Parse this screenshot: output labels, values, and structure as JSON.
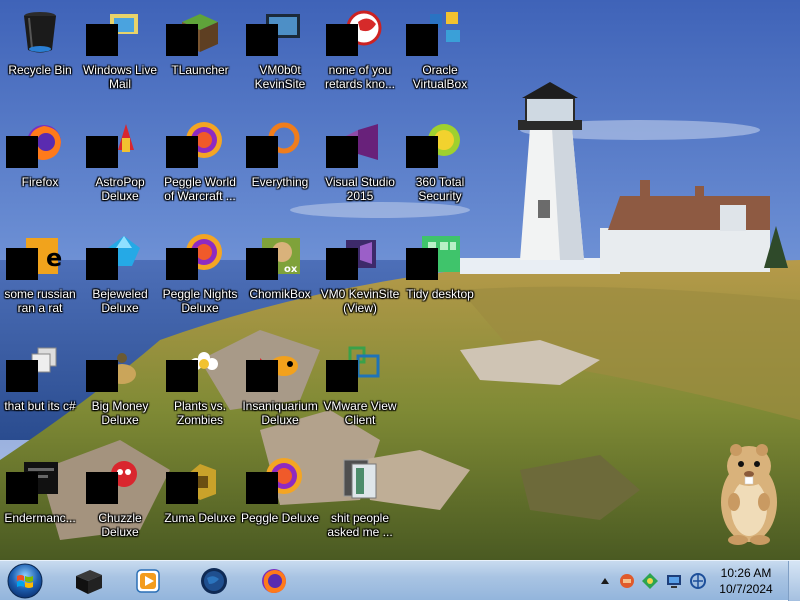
{
  "desktop": {
    "icons": [
      {
        "label": "Recycle Bin",
        "art": "recycle-bin-icon",
        "masked": false
      },
      {
        "label": "Windows Live Mail",
        "art": "mail-icon",
        "masked": true
      },
      {
        "label": "TLauncher",
        "art": "grass-block-icon",
        "masked": true
      },
      {
        "label": "VM0b0t KevinSite",
        "art": "monitor-icon",
        "masked": true
      },
      {
        "label": "none of you retards kno...",
        "art": "red-bird-icon",
        "masked": true
      },
      {
        "label": "Oracle VirtualBox",
        "art": "virtualbox-icon",
        "masked": true
      },
      {
        "label": "Firefox",
        "art": "firefox-icon",
        "masked": true
      },
      {
        "label": "AstroPop Deluxe",
        "art": "astropop-icon",
        "masked": true
      },
      {
        "label": "Peggle World of Warcraft ...",
        "art": "peggle-icon",
        "masked": true
      },
      {
        "label": "Everything",
        "art": "search-ring-icon",
        "masked": true
      },
      {
        "label": "Visual Studio 2015",
        "art": "visual-studio-icon",
        "masked": true
      },
      {
        "label": "360 Total Security",
        "art": "shield-plus-icon",
        "masked": true
      },
      {
        "label": "some russian ran a rat",
        "art": "document-icon",
        "masked": true
      },
      {
        "label": "Bejeweled Deluxe",
        "art": "gem-icon",
        "masked": true
      },
      {
        "label": "Peggle Nights Deluxe",
        "art": "peggle-icon",
        "masked": true
      },
      {
        "label": "ChomikBox",
        "art": "hamster-box-icon",
        "masked": true
      },
      {
        "label": "VM0 KevinSite (View)",
        "art": "vs-window-icon",
        "masked": true
      },
      {
        "label": "Tidy desktop",
        "art": "tidy-grid-icon",
        "masked": true
      },
      {
        "label": "that but its c#",
        "art": "stacked-windows-icon",
        "masked": true
      },
      {
        "label": "Big Money Deluxe",
        "art": "money-icon",
        "masked": true
      },
      {
        "label": "Plants vs. Zombies",
        "art": "flower-icon",
        "masked": true
      },
      {
        "label": "Insaniquarium Deluxe",
        "art": "fish-icon",
        "masked": true
      },
      {
        "label": "VMware View Client",
        "art": "vmware-icon",
        "masked": true
      },
      {
        "label": "Endermanc...",
        "art": "terminal-icon",
        "masked": true
      },
      {
        "label": "Chuzzle Deluxe",
        "art": "chuzzle-icon",
        "masked": true
      },
      {
        "label": "Zuma Deluxe",
        "art": "zuma-icon",
        "masked": true
      },
      {
        "label": "Peggle Deluxe",
        "art": "peggle-icon",
        "masked": true
      },
      {
        "label": "shit people asked me ...",
        "art": "folder-icon",
        "masked": false
      }
    ]
  },
  "taskbar": {
    "start_icon": "windows-start-icon",
    "pinned": [
      {
        "name": "taskbar-app-terminal",
        "icon": "black-box-icon"
      },
      {
        "name": "taskbar-app-media-player",
        "icon": "media-player-icon"
      },
      {
        "name": "taskbar-app-globe",
        "icon": "globe-icon"
      },
      {
        "name": "taskbar-app-firefox",
        "icon": "firefox-icon"
      }
    ],
    "tray": {
      "icons": [
        "show-hidden-icons-chevron",
        "red-tray-icon",
        "green-tray-icon",
        "display-tray-icon",
        "network-tray-icon"
      ],
      "time": "10:26 AM",
      "date": "10/7/2024"
    }
  }
}
